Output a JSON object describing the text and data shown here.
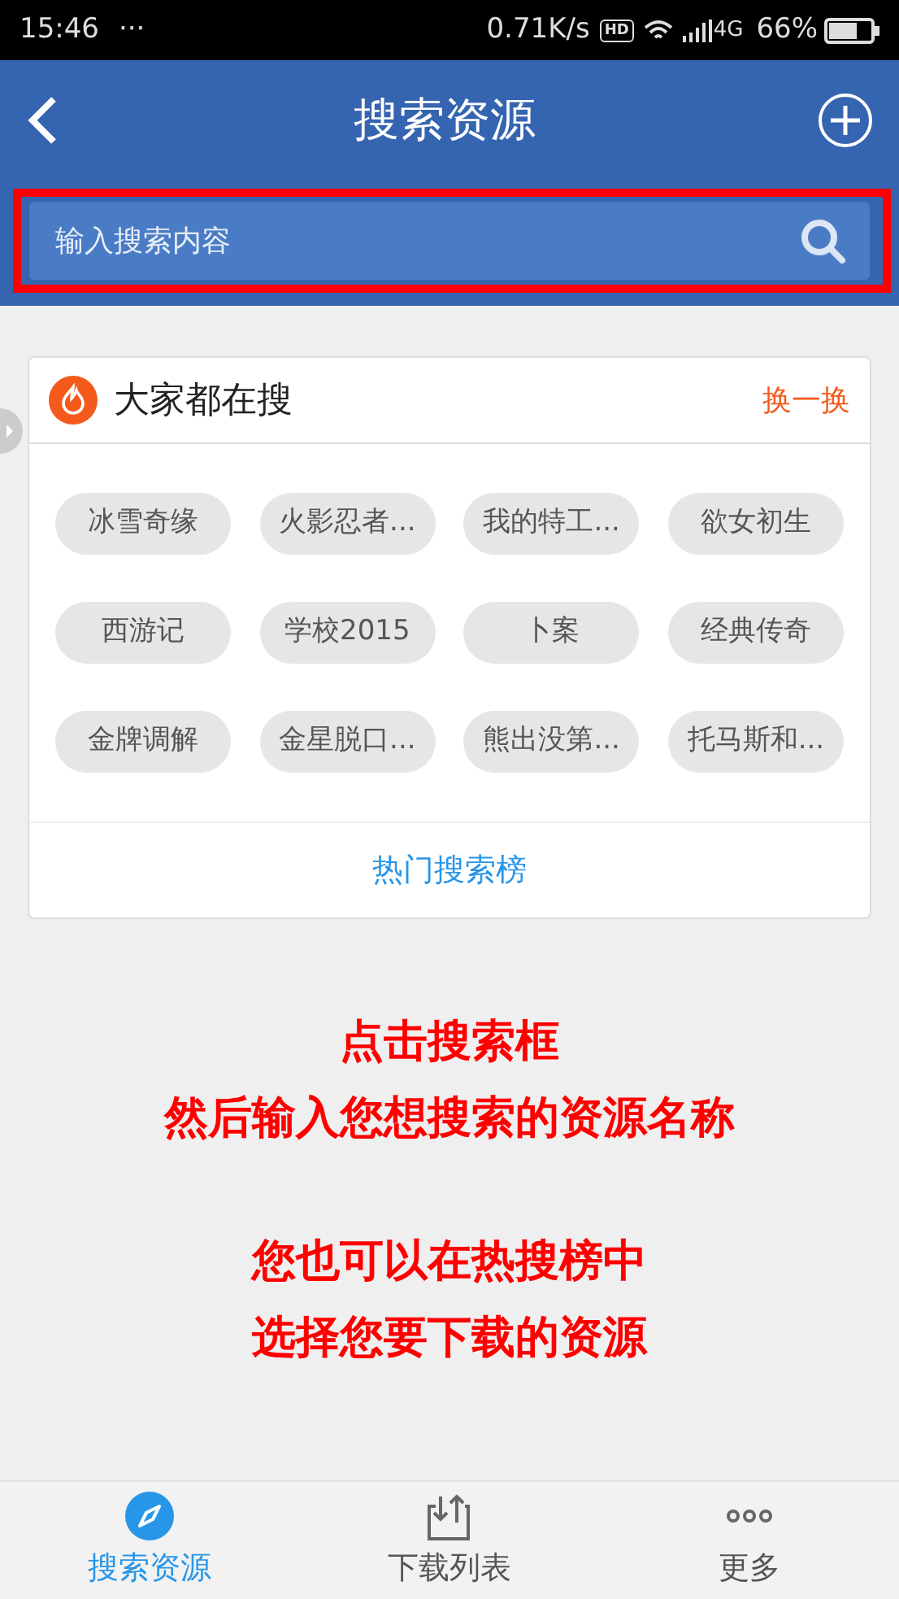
{
  "status_bar": {
    "time": "15:46",
    "more": "···",
    "speed": "0.71K/s",
    "hd": "HD",
    "network": "4G",
    "battery": "66%"
  },
  "header": {
    "title": "搜索资源"
  },
  "search": {
    "placeholder": "输入搜索内容",
    "highlighted": true
  },
  "hot": {
    "title": "大家都在搜",
    "refresh": "换一换",
    "tags": [
      "冰雪奇缘",
      "火影忍者...",
      "我的特工...",
      "欲女初生",
      "西游记",
      "学校2015",
      "卜案",
      "经典传奇",
      "金牌调解",
      "金星脱口...",
      "熊出没第...",
      "托马斯和..."
    ],
    "ranking_link": "热门搜索榜"
  },
  "annotations": [
    "点击搜索框",
    "然后输入您想搜索的资源名称",
    "您也可以在热搜榜中",
    "选择您要下载的资源"
  ],
  "tabs": [
    {
      "label": "搜索资源",
      "kind": "compass",
      "selected": true
    },
    {
      "label": "下载列表",
      "kind": "download",
      "selected": false
    },
    {
      "label": "更多",
      "kind": "more",
      "selected": false
    }
  ]
}
